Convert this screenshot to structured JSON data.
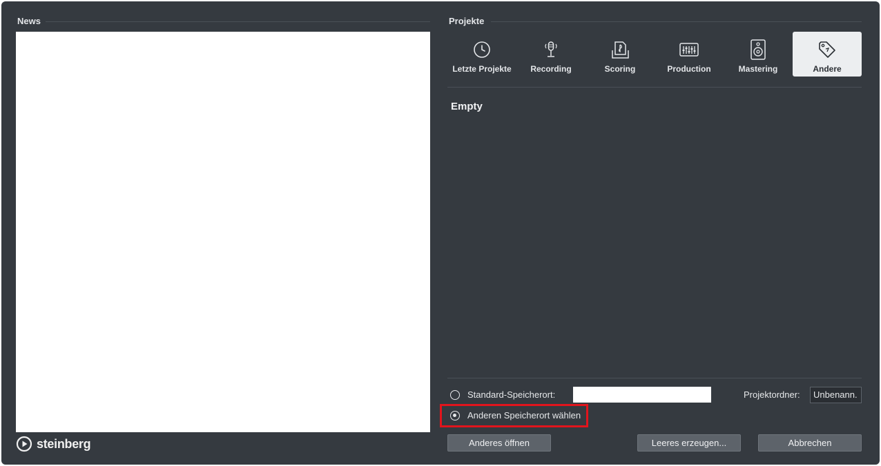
{
  "news": {
    "title": "News"
  },
  "brand": {
    "logo_text": "steinberg"
  },
  "projects": {
    "title": "Projekte",
    "tabs": [
      {
        "label": "Letzte Projekte",
        "icon": "clock-icon"
      },
      {
        "label": "Recording",
        "icon": "microphone-icon"
      },
      {
        "label": "Scoring",
        "icon": "score-icon"
      },
      {
        "label": "Production",
        "icon": "mixer-icon"
      },
      {
        "label": "Mastering",
        "icon": "speaker-icon"
      },
      {
        "label": "Andere",
        "icon": "tag-icon",
        "active": true
      }
    ],
    "empty_label": "Empty"
  },
  "location": {
    "standard_label": "Standard-Speicherort:",
    "standard_value": "",
    "other_label": "Anderen Speicherort wählen",
    "selected": "other",
    "folder_label": "Projektordner:",
    "folder_value": "Unbenann."
  },
  "buttons": {
    "open_other": "Anderes öffnen",
    "create_empty": "Leeres erzeugen...",
    "cancel": "Abbrechen"
  },
  "colors": {
    "window_bg": "#353a40",
    "highlight": "#e2141c",
    "active_tab": "#eceef0"
  }
}
